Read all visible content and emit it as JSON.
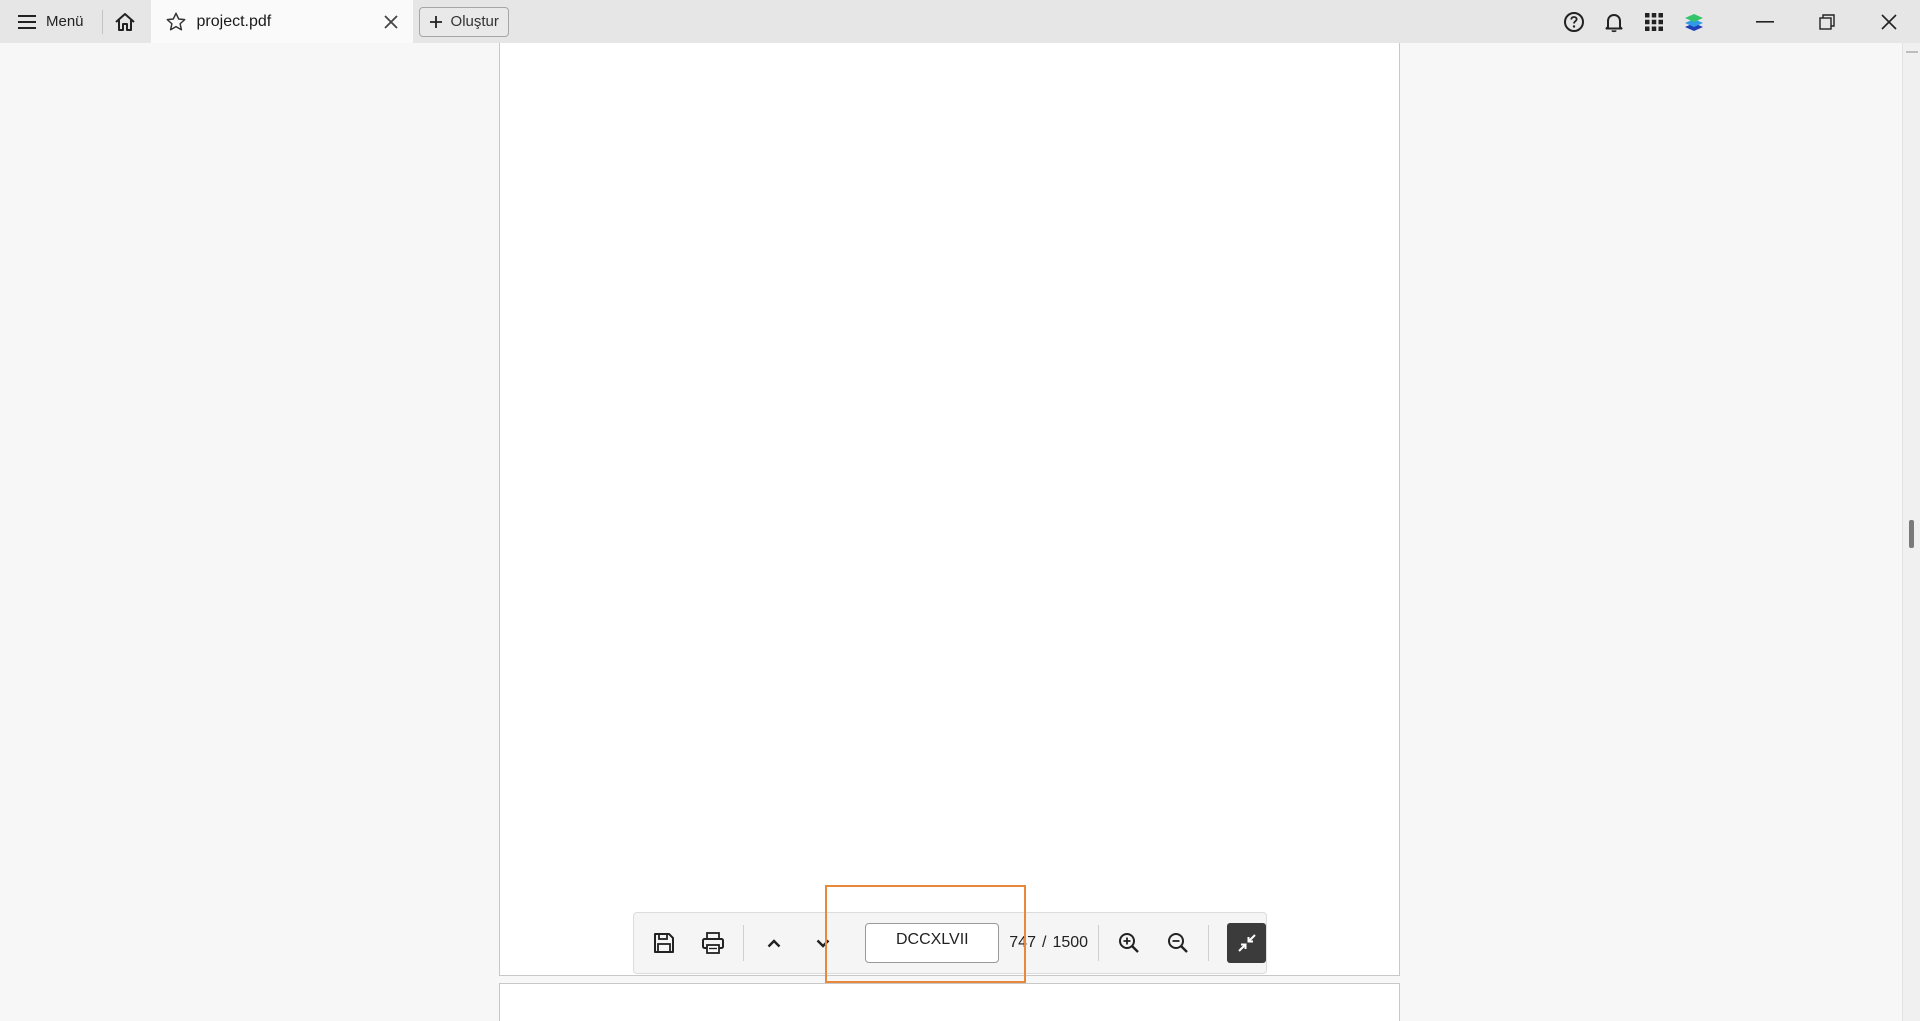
{
  "titlebar": {
    "menu_label": "Menü",
    "tab_title": "project.pdf",
    "new_label": "Oluştur"
  },
  "toolbar": {
    "page_input_value": "DCCXLVII",
    "current_page": "747",
    "separator": "/",
    "total_pages": "1500"
  },
  "colors": {
    "highlight": "#e8883a",
    "accent_dark": "#3b3b3b"
  }
}
